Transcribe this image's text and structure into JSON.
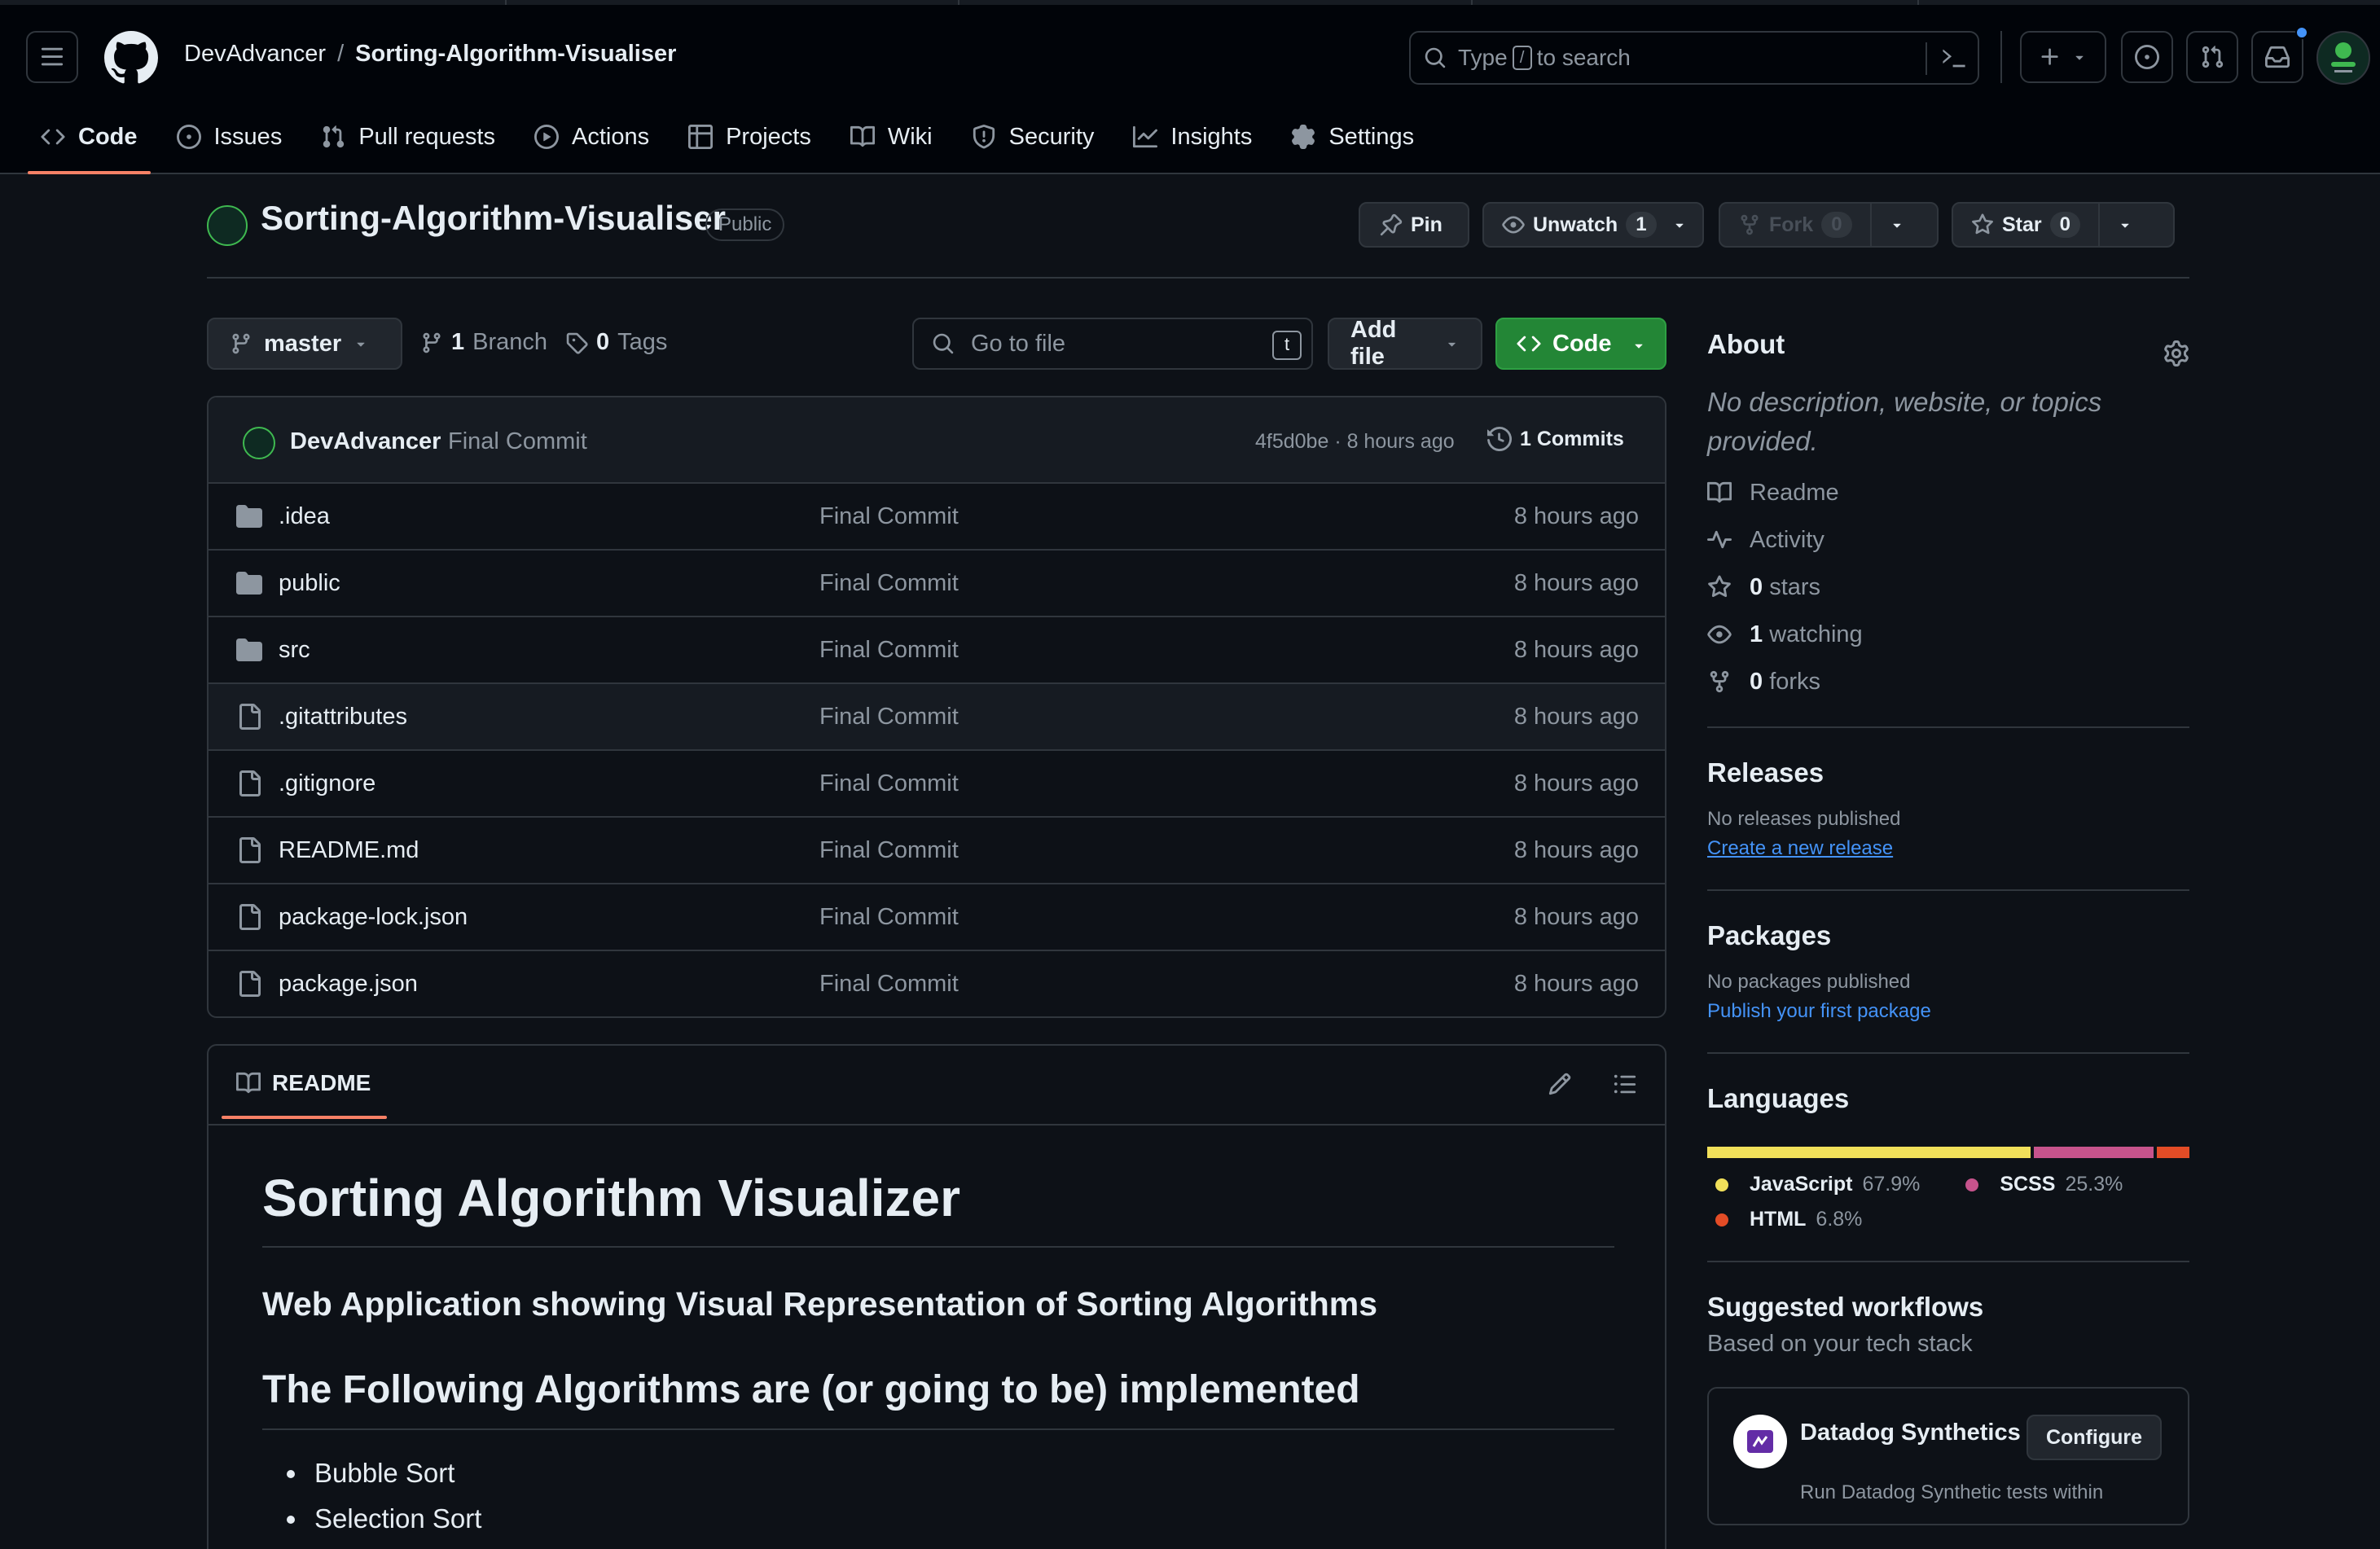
{
  "header": {
    "owner": "DevAdvancer",
    "separator": "/",
    "repo": "Sorting-Algorithm-Visualiser",
    "search_prefix": "Type",
    "search_key": "/",
    "search_suffix": "to search"
  },
  "nav": {
    "tabs": [
      {
        "label": "Code",
        "icon": "code-icon",
        "active": true
      },
      {
        "label": "Issues",
        "icon": "issue-opened-icon"
      },
      {
        "label": "Pull requests",
        "icon": "git-pull-request-icon"
      },
      {
        "label": "Actions",
        "icon": "play-icon"
      },
      {
        "label": "Projects",
        "icon": "table-icon"
      },
      {
        "label": "Wiki",
        "icon": "book-icon"
      },
      {
        "label": "Security",
        "icon": "shield-icon"
      },
      {
        "label": "Insights",
        "icon": "graph-icon"
      },
      {
        "label": "Settings",
        "icon": "gear-icon"
      }
    ]
  },
  "repo": {
    "title": "Sorting-Algorithm-Visualiser",
    "visibility": "Public",
    "pin_label": "Pin",
    "unwatch_label": "Unwatch",
    "watch_count": "1",
    "fork_label": "Fork",
    "fork_count": "0",
    "star_label": "Star",
    "star_count": "0"
  },
  "toolbar": {
    "branch": "master",
    "branch_count": "1",
    "branch_label": "Branch",
    "tag_count": "0",
    "tag_label": "Tags",
    "goto_placeholder": "Go to file",
    "goto_key": "t",
    "add_file_label": "Add file",
    "code_label": "Code"
  },
  "commit": {
    "author": "DevAdvancer",
    "message": "Final Commit",
    "meta": "4f5d0be · 8 hours ago",
    "count_label": "1 Commits"
  },
  "files": [
    {
      "name": ".idea",
      "type": "folder",
      "message": "Final Commit",
      "time": "8 hours ago"
    },
    {
      "name": "public",
      "type": "folder",
      "message": "Final Commit",
      "time": "8 hours ago"
    },
    {
      "name": "src",
      "type": "folder",
      "message": "Final Commit",
      "time": "8 hours ago"
    },
    {
      "name": ".gitattributes",
      "type": "file",
      "message": "Final Commit",
      "time": "8 hours ago"
    },
    {
      "name": ".gitignore",
      "type": "file",
      "message": "Final Commit",
      "time": "8 hours ago"
    },
    {
      "name": "README.md",
      "type": "file",
      "message": "Final Commit",
      "time": "8 hours ago"
    },
    {
      "name": "package-lock.json",
      "type": "file",
      "message": "Final Commit",
      "time": "8 hours ago"
    },
    {
      "name": "package.json",
      "type": "file",
      "message": "Final Commit",
      "time": "8 hours ago"
    }
  ],
  "readme": {
    "tab_label": "README",
    "h1": "Sorting Algorithm Visualizer",
    "h3": "Web Application showing Visual Representation of Sorting Algorithms",
    "h2": "The Following Algorithms are (or going to be) implemented",
    "list": [
      "Bubble Sort",
      "Selection Sort"
    ]
  },
  "about": {
    "heading": "About",
    "description": "No description, website, or topics provided.",
    "items": [
      {
        "icon": "book-icon",
        "strong": "",
        "text": "Readme"
      },
      {
        "icon": "pulse-icon",
        "strong": "",
        "text": "Activity"
      },
      {
        "icon": "star-icon",
        "strong": "0",
        "text": "stars"
      },
      {
        "icon": "eye-icon",
        "strong": "1",
        "text": "watching"
      },
      {
        "icon": "repo-forked-icon",
        "strong": "0",
        "text": "forks"
      }
    ]
  },
  "releases": {
    "heading": "Releases",
    "empty": "No releases published",
    "link": "Create a new release"
  },
  "packages": {
    "heading": "Packages",
    "empty": "No packages published",
    "link": "Publish your first package"
  },
  "languages": {
    "heading": "Languages",
    "items": [
      {
        "name": "JavaScript",
        "percent": "67.9%",
        "value": 67.9,
        "color": "#f1e05a"
      },
      {
        "name": "SCSS",
        "percent": "25.3%",
        "value": 25.3,
        "color": "#c6538c"
      },
      {
        "name": "HTML",
        "percent": "6.8%",
        "value": 6.8,
        "color": "#e34c26"
      }
    ]
  },
  "workflows": {
    "heading": "Suggested workflows",
    "subheading": "Based on your tech stack",
    "item_name": "Datadog Synthetics",
    "configure_label": "Configure",
    "item_desc": "Run Datadog Synthetic tests within"
  },
  "colors": {
    "background": "#0d1117",
    "accent_tab": "#f78166",
    "code_button": "#238636",
    "link": "#4493f8",
    "notification_dot": "#4493f8"
  }
}
